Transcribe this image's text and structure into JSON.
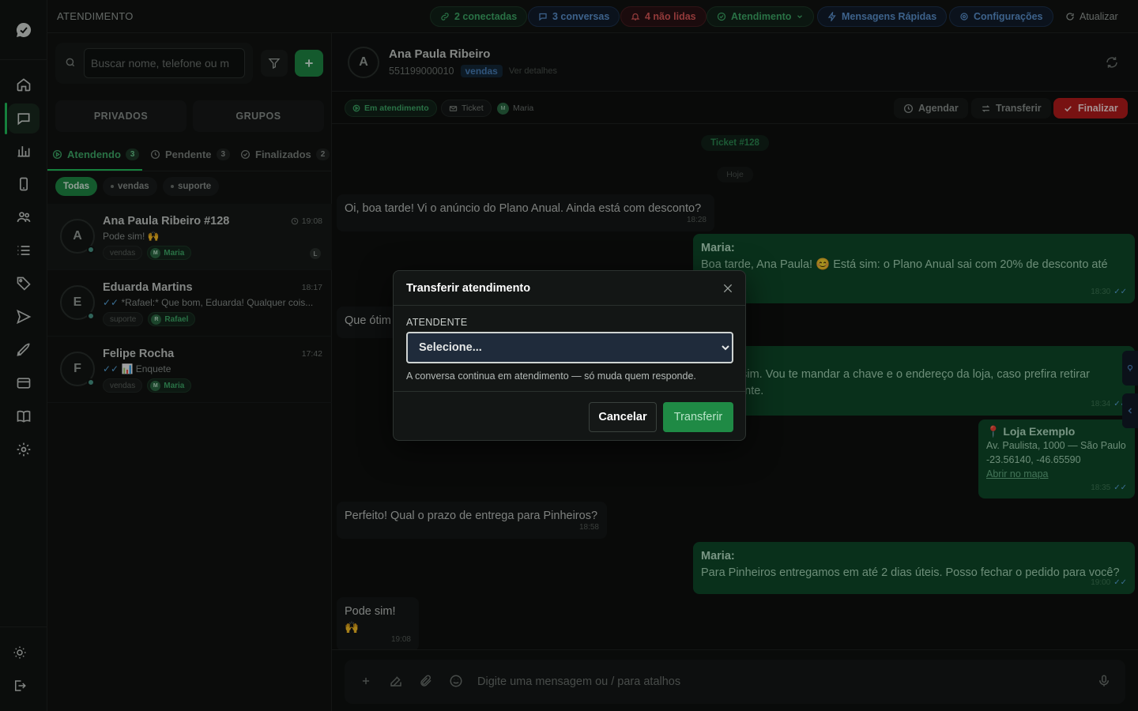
{
  "topbar": {
    "title": "ATENDIMENTO",
    "connected": "2 conectadas",
    "conversations": "3 conversas",
    "unread": "4 não lidas",
    "status": "Atendimento",
    "quick_messages": "Mensagens Rápidas",
    "settings": "Configurações",
    "refresh": "Atualizar"
  },
  "list": {
    "search_placeholder": "Buscar nome, telefone ou m",
    "segments": {
      "private": "PRIVADOS",
      "groups": "GRUPOS"
    },
    "tabs": [
      {
        "label": "Atendendo",
        "count": "3"
      },
      {
        "label": "Pendente",
        "count": "3"
      },
      {
        "label": "Finalizados",
        "count": "2"
      }
    ],
    "filters": {
      "all": "Todas",
      "sales": "vendas",
      "support": "suporte"
    },
    "conversations": [
      {
        "initial": "A",
        "name": "Ana Paula Ribeiro #128",
        "time": "19:08",
        "preview": "Pode sim! 🙌",
        "tag": "vendas",
        "agent": "Maria",
        "agent_initial": "M",
        "badge": "L"
      },
      {
        "initial": "E",
        "name": "Eduarda Martins",
        "time": "18:17",
        "preview": "*Rafael:* Que bom, Eduarda! Qualquer cois...",
        "tag": "suporte",
        "agent": "Rafael",
        "agent_initial": "R"
      },
      {
        "initial": "F",
        "name": "Felipe Rocha",
        "time": "17:42",
        "preview": "📊 Enquete",
        "tag": "vendas",
        "agent": "Maria",
        "agent_initial": "M"
      }
    ]
  },
  "chat": {
    "contact": {
      "initial": "A",
      "name": "Ana Paula Ribeiro",
      "phone": "551199000010",
      "dept": "vendas",
      "details": "Ver detalhes"
    },
    "status": {
      "attending": "Em atendimento",
      "ticket": "Ticket",
      "agent": "Maria",
      "agent_initial": "M"
    },
    "actions": {
      "schedule": "Agendar",
      "transfer": "Transferir",
      "finish": "Finalizar"
    },
    "ticket_pill": "Ticket #128",
    "day_pill": "Hoje",
    "messages": [
      {
        "text": "Oi, boa tarde! Vi o anúncio do Plano Anual. Ainda está com desconto?",
        "time": "18:28"
      },
      {
        "sender": "Maria:",
        "text": "Boa tarde, Ana Paula! 😊 Está sim: o Plano Anual sai com 20% de desconto até",
        "time": "18:30"
      },
      {
        "text": "Que ótim",
        "time": ""
      },
      {
        "text": "e sim. Vou te mandar a chave e o endereço da loja, caso prefira retirar",
        "text2": "nente.",
        "time": "18:34"
      },
      {
        "title": "📍 Loja Exemplo",
        "address": "Av. Paulista, 1000 — São Paulo",
        "coords": "-23.56140, -46.65590",
        "link": "Abrir no mapa",
        "time": "18:35"
      },
      {
        "text": "Perfeito! Qual o prazo de entrega para Pinheiros?",
        "time": "18:58"
      },
      {
        "sender": "Maria:",
        "text": "Para Pinheiros entregamos em até 2 dias úteis. Posso fechar o pedido para você?",
        "time": "19:00"
      },
      {
        "text": "Pode sim! 🙌",
        "time": "19:08"
      }
    ],
    "composer_placeholder": "Digite uma mensagem ou / para atalhos"
  },
  "modal": {
    "title": "Transferir atendimento",
    "label": "ATENDENTE",
    "select_value": "Selecione...",
    "hint": "A conversa continua em atendimento — só muda quem responde.",
    "cancel": "Cancelar",
    "confirm": "Transferir"
  }
}
